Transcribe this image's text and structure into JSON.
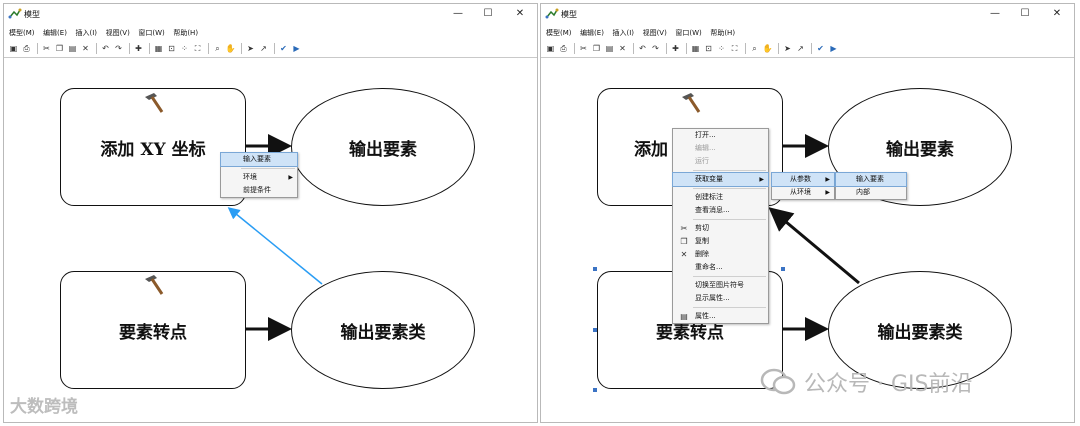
{
  "left_window": {
    "title": "模型",
    "menus": [
      "模型(M)",
      "编辑(E)",
      "插入(I)",
      "视图(V)",
      "窗口(W)",
      "帮助(H)"
    ],
    "nodes": {
      "tool_top": "添加 XY 坐标",
      "output_top": "输出要素",
      "tool_bottom": "要素转点",
      "output_bottom": "输出要素类"
    },
    "context_menu": {
      "items": [
        "输入要素",
        "环境",
        "前提条件"
      ]
    }
  },
  "right_window": {
    "title": "模型",
    "menus": [
      "模型(M)",
      "编辑(E)",
      "插入(I)",
      "视图(V)",
      "窗口(W)",
      "帮助(H)"
    ],
    "nodes": {
      "tool_top": "添加",
      "output_top": "输出要素",
      "tool_bottom": "要素转点",
      "output_bottom": "输出要素类"
    },
    "context_menu": {
      "items": [
        "打开...",
        "编辑...",
        "运行",
        "获取变量",
        "创建标注",
        "查看消息...",
        "剪切",
        "复制",
        "删除",
        "重命名...",
        "切换至图片符号",
        "显示属性...",
        "属性..."
      ]
    },
    "submenu_1": {
      "items": [
        "从参数",
        "从环境"
      ]
    },
    "submenu_2": {
      "items": [
        "输入要素",
        "内部"
      ]
    }
  },
  "watermarks": {
    "left": "大数跨境",
    "right": "公众号 · GIS前沿"
  },
  "colors": {
    "highlight": "#cfe3f7",
    "connector_blue": "#2a9df4",
    "handle_blue": "#3b73c4"
  },
  "icons": [
    "app-model-icon",
    "minimize-icon",
    "maximize-icon",
    "close-icon",
    "hammer-icon",
    "scissors-icon",
    "copy-icon",
    "delete-icon",
    "properties-icon"
  ]
}
